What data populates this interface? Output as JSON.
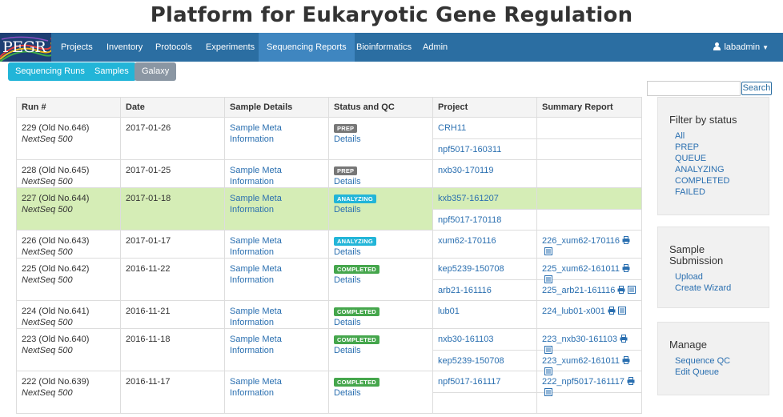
{
  "site_title": "Platform for Eukaryotic Gene Regulation",
  "logo_text": "PEGR",
  "nav": {
    "items": [
      "Projects",
      "Inventory",
      "Protocols",
      "Experiments",
      "Sequencing Reports",
      "Bioinformatics",
      "Admin"
    ],
    "active": "Sequencing Reports",
    "user": "labadmin"
  },
  "subtabs": [
    "Sequencing Runs",
    "Samples",
    "Galaxy"
  ],
  "search": {
    "value": "",
    "button": "Search"
  },
  "table": {
    "headers": [
      "Run #",
      "Date",
      "Sample Details",
      "Status and QC",
      "Project",
      "Summary Report"
    ],
    "rows": [
      {
        "run": "229 (Old No.646)",
        "machine": "NextSeq 500",
        "date": "2017-01-26",
        "details": "Sample Meta Information",
        "status": "PREP",
        "qc": "Details",
        "projects": [
          "CRH11",
          "npf5017-160311"
        ],
        "reports": [
          "",
          ""
        ]
      },
      {
        "run": "228 (Old No.645)",
        "machine": "NextSeq 500",
        "date": "2017-01-25",
        "details": "Sample Meta Information",
        "status": "PREP",
        "qc": "Details",
        "projects": [
          "nxb30-170119"
        ],
        "reports": [
          ""
        ]
      },
      {
        "run": "227 (Old No.644)",
        "machine": "NextSeq 500",
        "date": "2017-01-18",
        "details": "Sample Meta Information",
        "status": "ANALYZING",
        "qc": "Details",
        "projects": [
          "kxb357-161207",
          "npf5017-170118"
        ],
        "reports": [
          "",
          ""
        ]
      },
      {
        "run": "226 (Old No.643)",
        "machine": "NextSeq 500",
        "date": "2017-01-17",
        "details": "Sample Meta Information",
        "status": "ANALYZING",
        "qc": "Details",
        "projects": [
          "xum62-170116"
        ],
        "reports": [
          "226_xum62-170116"
        ]
      },
      {
        "run": "225 (Old No.642)",
        "machine": "NextSeq 500",
        "date": "2016-11-22",
        "details": "Sample Meta Information",
        "status": "COMPLETED",
        "qc": "Details",
        "projects": [
          "kep5239-150708",
          "arb21-161116"
        ],
        "reports": [
          "225_xum62-161011",
          "225_arb21-161116"
        ]
      },
      {
        "run": "224 (Old No.641)",
        "machine": "NextSeq 500",
        "date": "2016-11-21",
        "details": "Sample Meta Information",
        "status": "COMPLETED",
        "qc": "Details",
        "projects": [
          "lub01"
        ],
        "reports": [
          "224_lub01-x001"
        ]
      },
      {
        "run": "223 (Old No.640)",
        "machine": "NextSeq 500",
        "date": "2016-11-18",
        "details": "Sample Meta Information",
        "status": "COMPLETED",
        "qc": "Details",
        "projects": [
          "nxb30-161103",
          "kep5239-150708"
        ],
        "reports": [
          "223_nxb30-161103",
          "223_xum62-161011"
        ]
      },
      {
        "run": "222 (Old No.639)",
        "machine": "NextSeq 500",
        "date": "2016-11-17",
        "details": "Sample Meta Information",
        "status": "COMPLETED",
        "qc": "Details",
        "projects": [
          "npf5017-161117",
          ""
        ],
        "reports": [
          "222_npf5017-161117",
          ""
        ]
      }
    ]
  },
  "sidebar": {
    "filter": {
      "title": "Filter by status",
      "links": [
        "All",
        "PREP",
        "QUEUE",
        "ANALYZING",
        "COMPLETED",
        "FAILED"
      ]
    },
    "submission": {
      "title_line1": "Sample",
      "title_line2": "Submission",
      "links": [
        "Upload",
        "Create Wizard"
      ]
    },
    "manage": {
      "title": "Manage",
      "links": [
        "Sequence QC",
        "Edit Queue"
      ]
    }
  },
  "colors": {
    "navbar": "#2b6ea2",
    "active_nav": "#3f86c0",
    "link": "#2a6fb0",
    "highlight_row": "#d5edb6",
    "badge_prep": "#777777",
    "badge_analyzing": "#22b5d8",
    "badge_completed": "#45a64c",
    "subtab_cyan": "#22b5d8",
    "subtab_gray": "#8a96a3"
  },
  "icons": {
    "print": "printer-icon",
    "report": "report-icon",
    "user": "user-icon"
  }
}
